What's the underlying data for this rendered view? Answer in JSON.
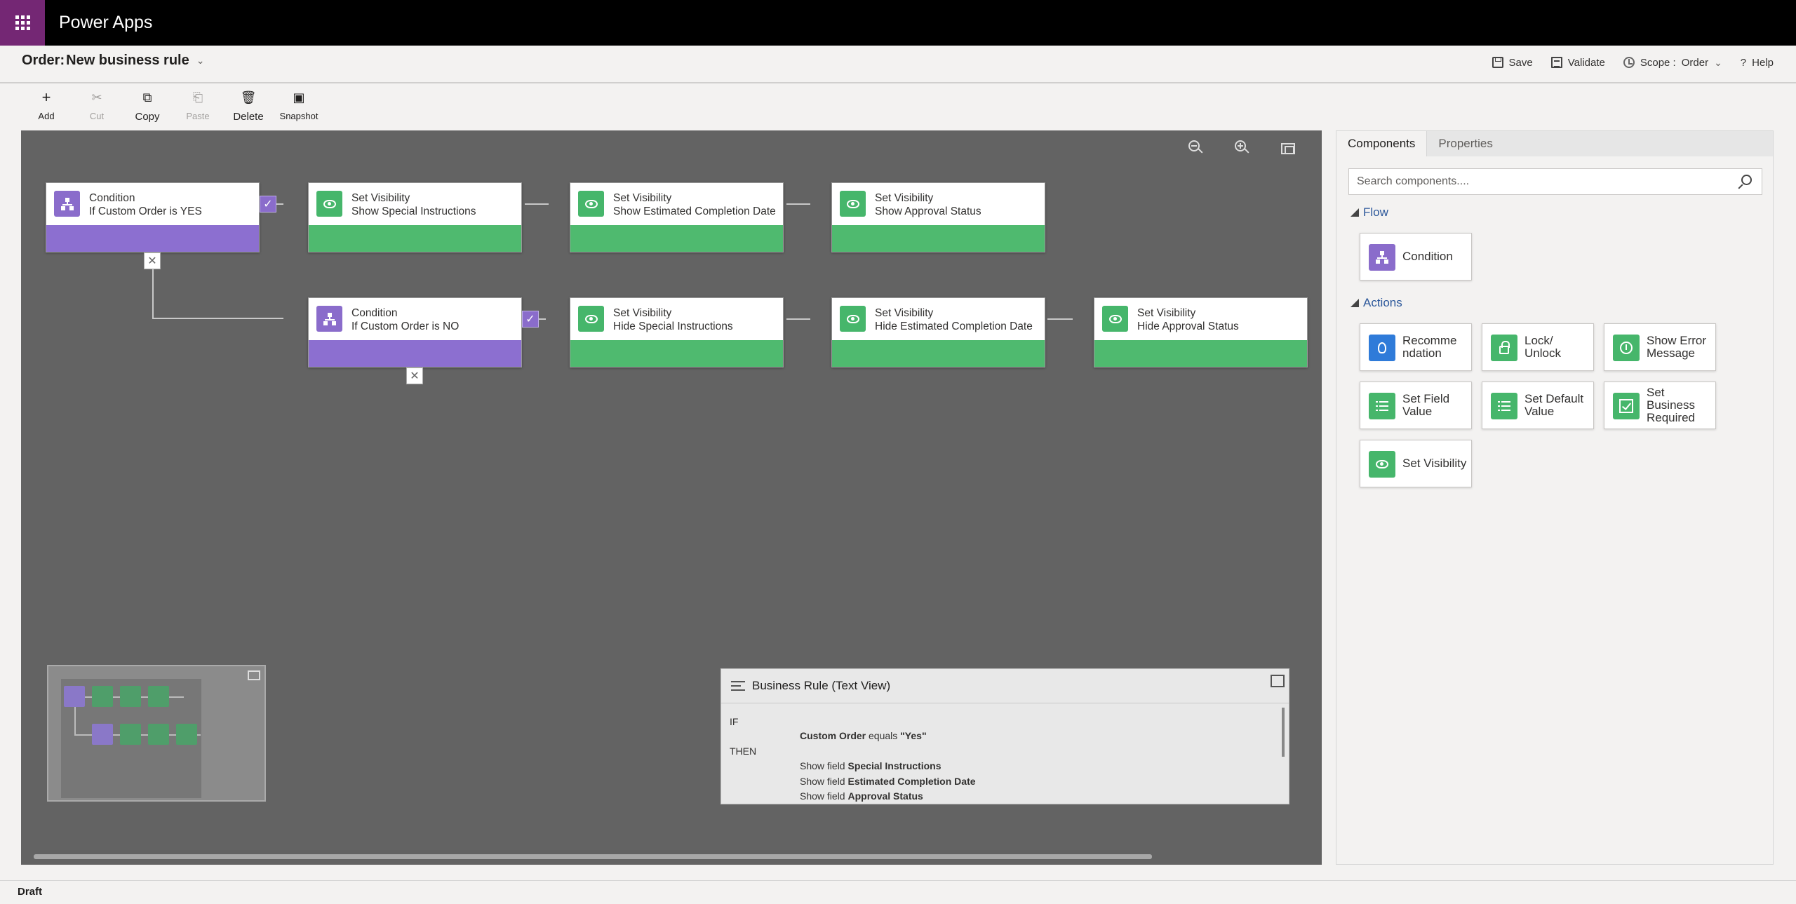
{
  "app": {
    "title": "Power Apps"
  },
  "header": {
    "entity": "Order:",
    "rule_name": "New business rule",
    "save": "Save",
    "validate": "Validate",
    "scope_label": "Scope :",
    "scope_value": "Order",
    "help": "Help"
  },
  "toolbar": {
    "add": "Add",
    "cut": "Cut",
    "copy": "Copy",
    "paste": "Paste",
    "delete": "Delete",
    "snapshot": "Snapshot"
  },
  "canvas": {
    "nodes": [
      {
        "type": "Condition",
        "detail": "If Custom Order is YES"
      },
      {
        "type": "Set Visibility",
        "detail": "Show Special Instructions"
      },
      {
        "type": "Set Visibility",
        "detail": "Show Estimated Completion Date"
      },
      {
        "type": "Set Visibility",
        "detail": "Show Approval Status"
      },
      {
        "type": "Condition",
        "detail": "If Custom Order is NO"
      },
      {
        "type": "Set Visibility",
        "detail": "Hide Special Instructions"
      },
      {
        "type": "Set Visibility",
        "detail": "Hide Estimated Completion Date"
      },
      {
        "type": "Set Visibility",
        "detail": "Hide Approval Status"
      }
    ]
  },
  "textview": {
    "title": "Business Rule (Text View)",
    "if_label": "IF",
    "condition_field": "Custom Order",
    "condition_op": "equals",
    "condition_value": "\"Yes\"",
    "then_label": "THEN",
    "actions": [
      {
        "prefix": "Show field",
        "field": "Special Instructions"
      },
      {
        "prefix": "Show field",
        "field": "Estimated Completion Date"
      },
      {
        "prefix": "Show field",
        "field": "Approval Status"
      }
    ]
  },
  "panel": {
    "tabs": [
      "Components",
      "Properties"
    ],
    "search_placeholder": "Search components....",
    "flow_label": "Flow",
    "actions_label": "Actions",
    "flow_items": [
      {
        "label": "Condition",
        "icon": "condition-icon"
      }
    ],
    "action_items": [
      {
        "label": "Recomme ndation",
        "icon": "lightbulb-icon"
      },
      {
        "label": "Lock/ Unlock",
        "icon": "lock-icon"
      },
      {
        "label": "Show Error Message",
        "icon": "error-icon"
      },
      {
        "label": "Set Field Value",
        "icon": "list-check-icon"
      },
      {
        "label": "Set Default Value",
        "icon": "list-check-icon"
      },
      {
        "label": "Set Business Required",
        "icon": "checkbox-icon"
      },
      {
        "label": "Set Visibility",
        "icon": "eye-icon"
      }
    ]
  },
  "status": {
    "text": "Draft"
  },
  "colors": {
    "brand": "#742774",
    "condition": "#8a6ccb",
    "action": "#46b66b",
    "canvas": "#636363"
  }
}
